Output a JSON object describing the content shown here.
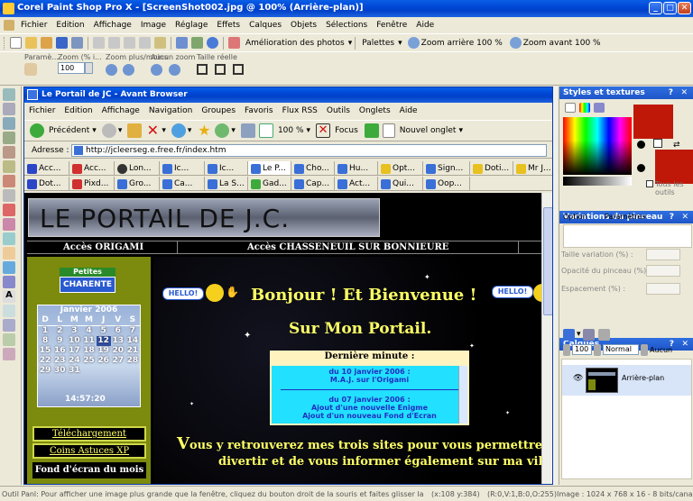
{
  "app_title": "Corel Paint Shop Pro X - [ScreenShot002.jpg @ 100% (Arrière-plan)]",
  "psp_menu": [
    "Fichier",
    "Edition",
    "Affichage",
    "Image",
    "Réglage",
    "Effets",
    "Calques",
    "Objets",
    "Sélections",
    "Fenêtre",
    "Aide"
  ],
  "psp_toolbar": {
    "enhance": "Amélioration des photos",
    "palettes": "Palettes",
    "zoom_out": "Zoom arrière 100 %",
    "zoom_in": "Zoom avant 100 %"
  },
  "tool_options": {
    "param": "Paramè...",
    "zoom_pct_label": "Zoom (% i...",
    "zoom_value": "100",
    "zoom_plusminus": "Zoom plus/moins",
    "last_zoom": "Aucun zoom",
    "actual_size": "Taille réelle"
  },
  "browser": {
    "title": "Le Portail de JC - Avant Browser",
    "menu": [
      "Fichier",
      "Edition",
      "Affichage",
      "Navigation",
      "Groupes",
      "Favoris",
      "Flux RSS",
      "Outils",
      "Onglets",
      "Aide"
    ],
    "back": "Précédent",
    "zoom": "100 %",
    "focus": "Focus",
    "new_tab": "Nouvel onglet",
    "address_label": "Adresse :",
    "address": "http://jcleerseg.e.free.fr/index.htm",
    "tabs_row1": [
      "Acc...",
      "Acc...",
      "Lon...",
      "Ic...",
      "Ic...",
      "Le P...",
      "Cho...",
      "Hu...",
      "Opt...",
      "Sign...",
      "Doti...",
      "Mr J..."
    ],
    "tabs_row2": [
      "Dot...",
      "Pixd...",
      "Gro...",
      "Ca...",
      "La S...",
      "Gad...",
      "Cap...",
      "Act...",
      "Qui...",
      "Oop..."
    ]
  },
  "site": {
    "logo": "LE PORTAIL DE J.C.",
    "nav1": "Accès ORIGAMI",
    "nav2": "Accès CHASSENEUIL SUR BONNIEURE",
    "badge_top": "Petites",
    "badge_bottom": "CHARENTE",
    "calendar_title": "Janvier 2006",
    "calendar_days": [
      "D",
      "L",
      "M",
      "M",
      "J",
      "V",
      "S"
    ],
    "calendar_numbers": [
      "1",
      "2",
      "3",
      "4",
      "5",
      "6",
      "7",
      "8",
      "9",
      "10",
      "11",
      "12",
      "13",
      "14",
      "15",
      "16",
      "17",
      "18",
      "19",
      "20",
      "21",
      "22",
      "23",
      "24",
      "25",
      "26",
      "27",
      "28",
      "29",
      "30",
      "31"
    ],
    "time": "14:57:20",
    "hello": "HELLO!",
    "welcome": "Bonjour ! Et Bienvenue !",
    "portal": "Sur Mon Portail.",
    "news_title": "Dernière minute :",
    "news1_date": "du 10 janvier 2006 :",
    "news1_text": "M.A.J. sur l'Origami",
    "news2_date": "du 07 janvier 2006 :",
    "news2_line1": "Ajout d'une nouvelle Enigme",
    "news2_line2": "Ajout d'un nouveau Fond d'Ecran",
    "side_btn1": "Téléchargement",
    "side_btn2": "Coins Astuces XP",
    "side_btn3": "Fond d'écran du mois",
    "intro_initial": "V",
    "intro_line1": "ous y retrouverez mes trois sites pour vous permettre de vo",
    "intro_line2": "divertir et de vous informer également sur ma ville."
  },
  "right_panels": {
    "materials": "Styles et textures",
    "all_tools": "Tous les outils",
    "brush_var": "Variations du pinceau",
    "col_option": "Option",
    "col_params": "Paramètres",
    "brush_rows": [
      "Taille variation (%) :",
      "Opacité du pinceau (%) :",
      "Espacement (%) :"
    ],
    "layers": "Calques",
    "opacity": "100",
    "blend": "Normal",
    "none": "Aucun",
    "layer_name": "Arrière-plan"
  },
  "status": {
    "text": "Outil Panl: Pour afficher une image plus grande que la fenêtre, cliquez du bouton droit de la souris et faites glisser la sélection",
    "coords": "(x:108 y:384)",
    "rgb": "(R:0,V:1,B:0,O:255)",
    "image": "Image : 1024 x 768 x 16 - 8 bits/canal"
  },
  "colors": {
    "xp_blue": "#0a5fe6",
    "face": "#ece9d8",
    "site_bg": "#000000",
    "sidebar_olive": "#7c8a0e",
    "headline_yellow": "#ffff66",
    "news_cyan": "#22e0ff",
    "swatch_red": "#c01808"
  }
}
